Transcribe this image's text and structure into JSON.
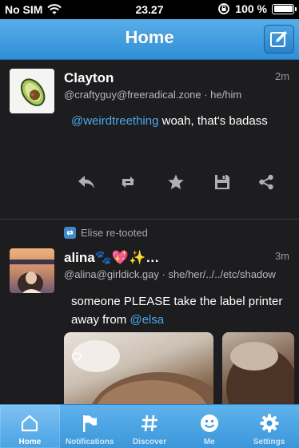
{
  "status_bar": {
    "carrier": "No SIM",
    "time": "23.27",
    "battery_percent": "100 %",
    "battery_level": 1.0
  },
  "nav": {
    "title": "Home",
    "compose_icon": "compose-icon"
  },
  "posts": [
    {
      "name": "Clayton",
      "handle": "@craftyguy@freeradical.zone · he/him",
      "time": "2m",
      "mention": "@weirdtreething",
      "text_rest": " woah, that's badass",
      "avatar": "avocado"
    },
    {
      "boosted_by": "Elise re-tooted",
      "name": "alina🐾💖✨…",
      "handle": "@alina@girldick.gay · she/her/../../etc/shadow",
      "time": "3m",
      "text_before": "someone PLEASE take the label printer away from ",
      "mention": "@elsa",
      "avatar": "photo"
    }
  ],
  "actions": [
    "reply-icon",
    "boost-icon",
    "favourite-icon",
    "bookmark-icon",
    "share-icon"
  ],
  "tabs": [
    {
      "label": "Home",
      "icon": "home-icon",
      "active": true
    },
    {
      "label": "Notifications",
      "icon": "flag-icon",
      "active": false
    },
    {
      "label": "Discover",
      "icon": "hashtag-icon",
      "active": false
    },
    {
      "label": "Me",
      "icon": "smiley-icon",
      "active": false
    },
    {
      "label": "Settings",
      "icon": "gear-icon",
      "active": false
    }
  ],
  "colors": {
    "accent": "#3b97da",
    "link": "#4aa8ec",
    "background": "#1d1d1f"
  }
}
